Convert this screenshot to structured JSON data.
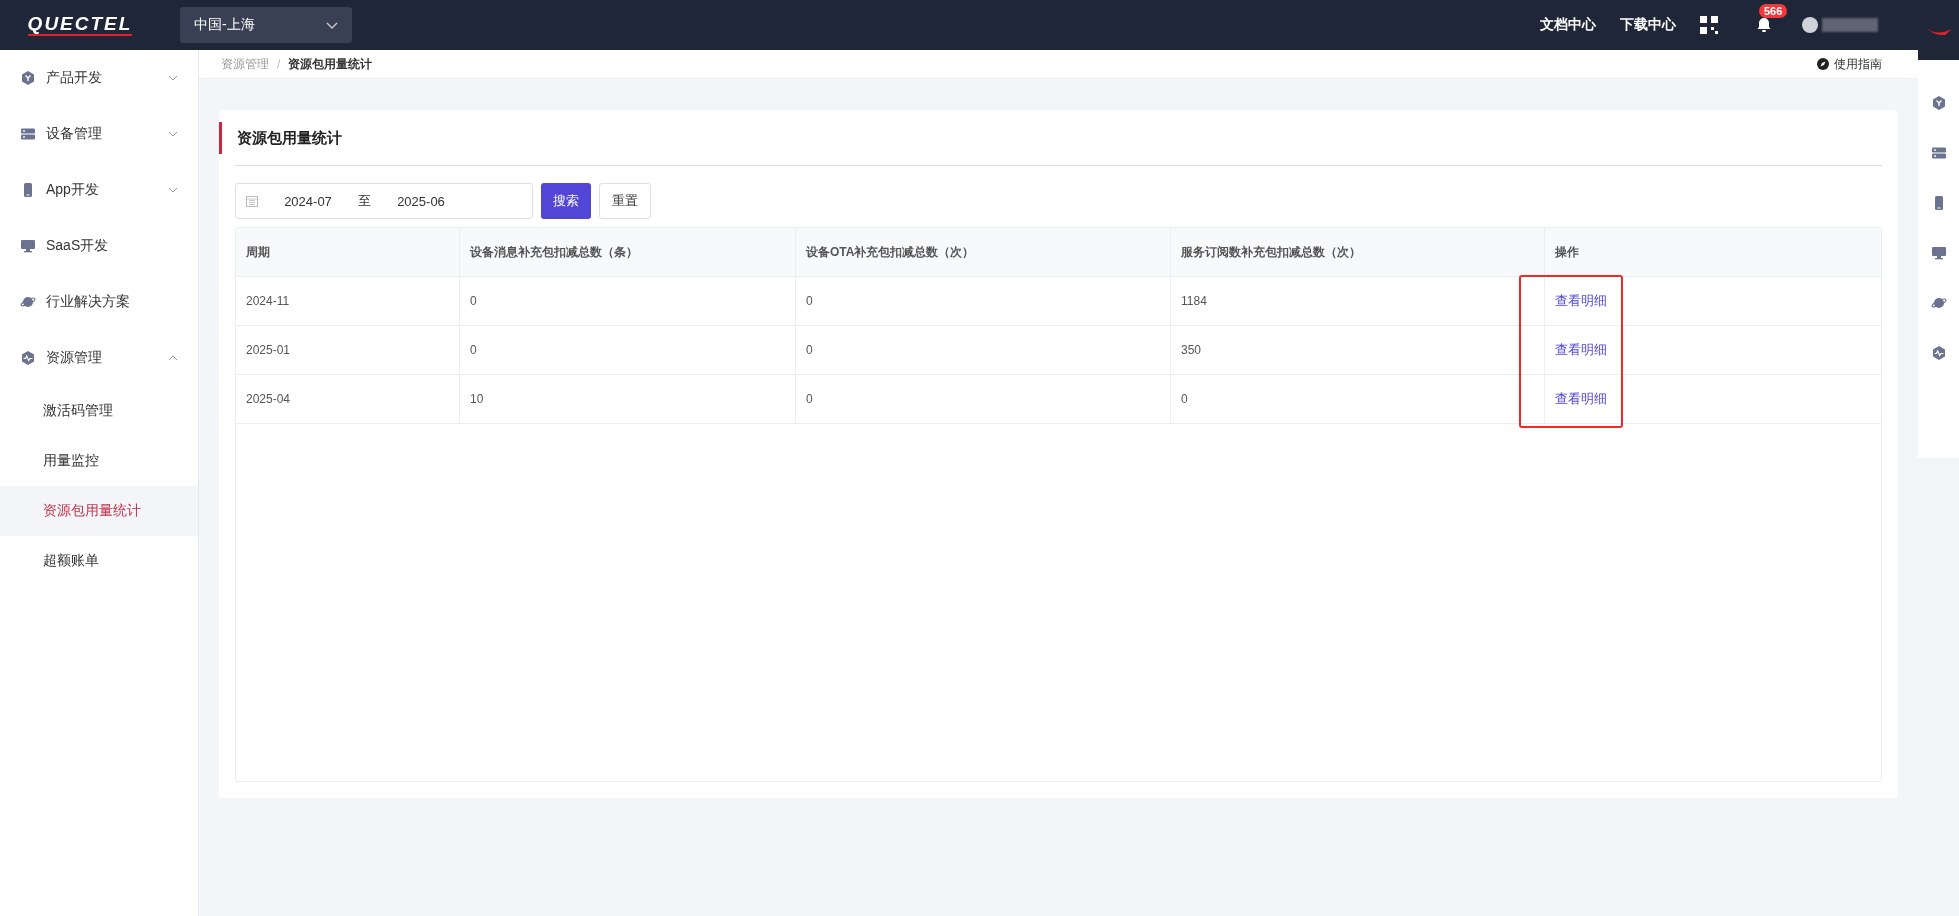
{
  "topbar": {
    "logo": "QUECTEL",
    "region": "中国-上海",
    "links": [
      "文档中心",
      "下载中心"
    ],
    "notification_count": "566"
  },
  "sidebar": {
    "items": [
      {
        "label": "产品开发",
        "kind": "group",
        "expanded": false
      },
      {
        "label": "设备管理",
        "kind": "group",
        "expanded": false
      },
      {
        "label": "App开发",
        "kind": "group",
        "expanded": false
      },
      {
        "label": "SaaS开发",
        "kind": "link"
      },
      {
        "label": "行业解决方案",
        "kind": "link"
      },
      {
        "label": "资源管理",
        "kind": "group",
        "expanded": true,
        "children": [
          {
            "label": "激活码管理",
            "selected": false
          },
          {
            "label": "用量监控",
            "selected": false
          },
          {
            "label": "资源包用量统计",
            "selected": true
          },
          {
            "label": "超额账单",
            "selected": false
          }
        ]
      }
    ]
  },
  "breadcrumb": {
    "items": [
      "资源管理",
      "资源包用量统计"
    ],
    "separator": "/"
  },
  "guide_link": "使用指南",
  "card": {
    "title": "资源包用量统计",
    "filter": {
      "start": "2024-07",
      "separator": "至",
      "end": "2025-06",
      "search_button": "搜索",
      "reset_button": "重置"
    },
    "table": {
      "columns": [
        {
          "label": "周期",
          "highlighted": false
        },
        {
          "label": "设备消息补充包扣减总数（条）",
          "highlighted": false
        },
        {
          "label": "设备OTA补充包扣减总数（次）",
          "highlighted": false
        },
        {
          "label": "服务订阅数补充包扣减总数（次）",
          "highlighted": false
        },
        {
          "label": "操作",
          "highlighted": true
        }
      ],
      "rows": [
        [
          "2024-11",
          "0",
          "0",
          "1184",
          "查看明细"
        ],
        [
          "2025-01",
          "0",
          "0",
          "350",
          "查看明细"
        ],
        [
          "2025-04",
          "10",
          "0",
          "0",
          "查看明细"
        ]
      ]
    }
  }
}
